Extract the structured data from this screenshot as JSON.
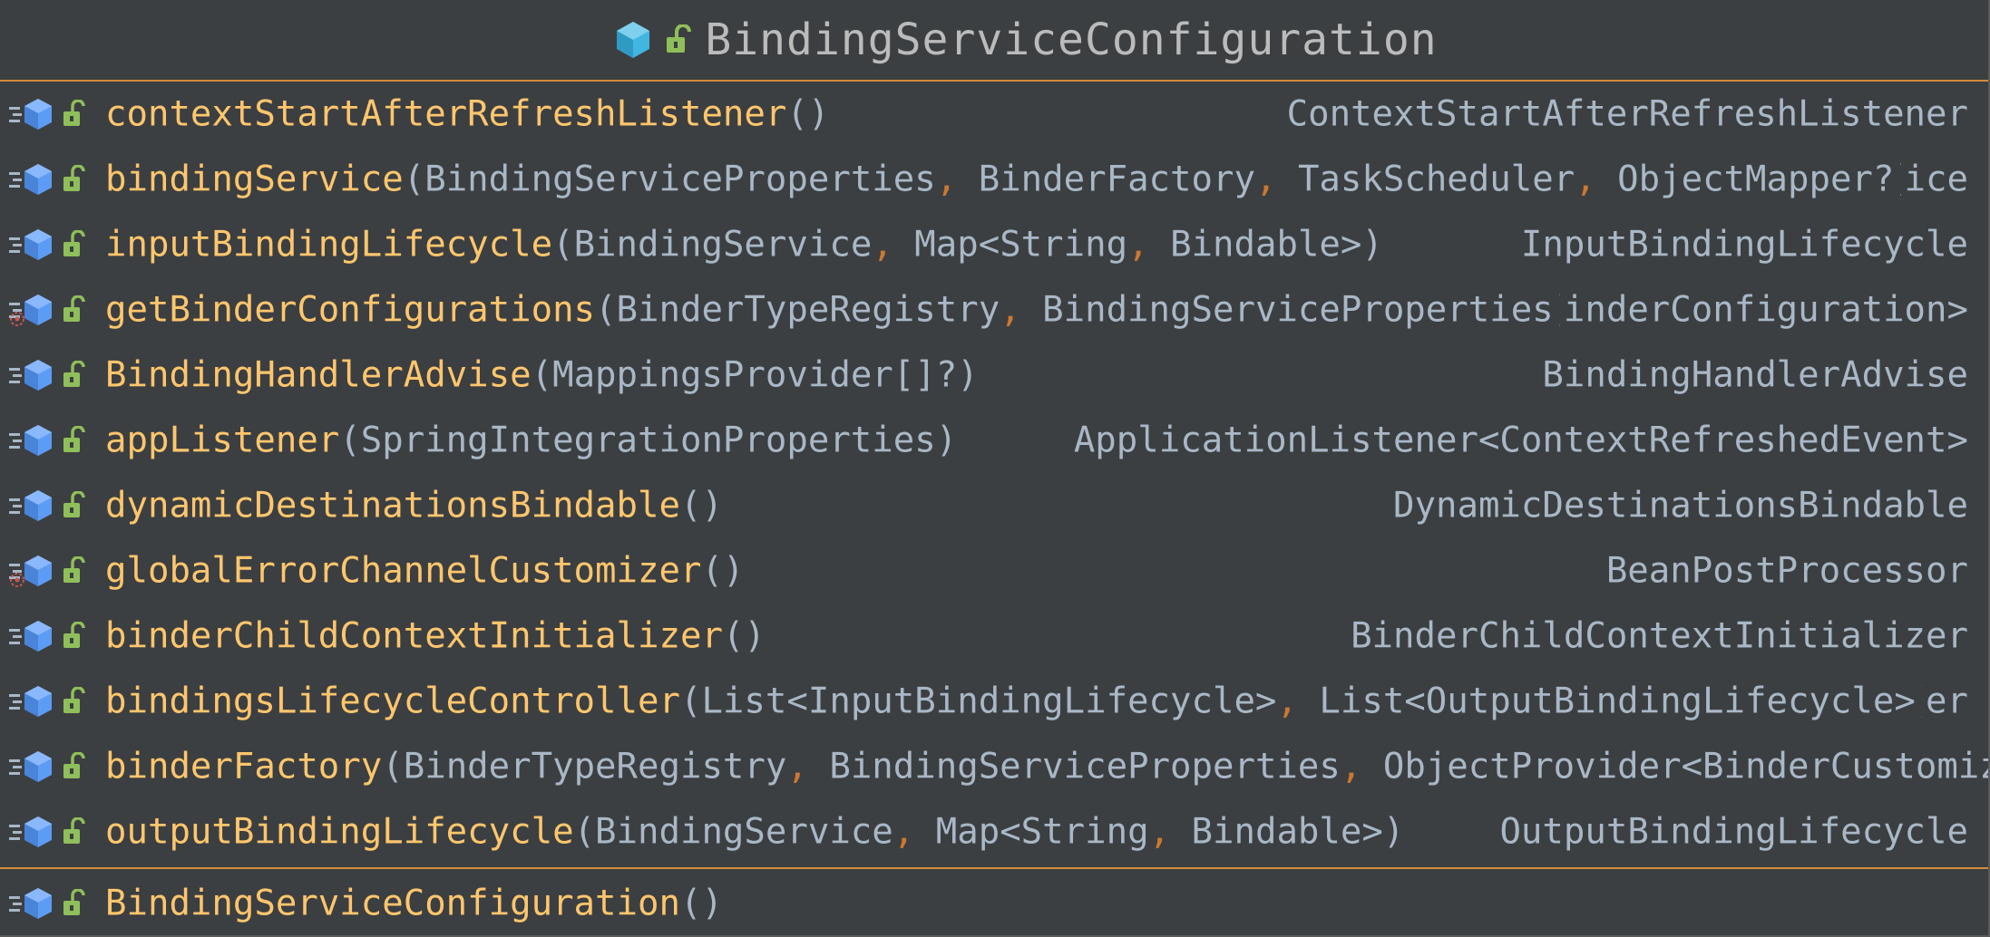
{
  "class_name": "BindingServiceConfiguration",
  "colors": {
    "background": "#3c3f41",
    "separator": "#d38b3a",
    "method_name": "#ffc66d",
    "text": "#a9b7c6",
    "comma": "#cc7832",
    "class_icon": "#40b6e0",
    "method_icon": "#5c9cf5",
    "lock_icon": "#8fbf5a",
    "bean_marker": "#c75450"
  },
  "methods": [
    {
      "name": "contextStartAfterRefreshListener",
      "params": "",
      "return_type": "ContextStartAfterRefreshListener",
      "bean_marker": false
    },
    {
      "name": "bindingService",
      "params": "BindingServiceProperties, BinderFactory, TaskScheduler, ObjectMapper?",
      "return_type": "ice",
      "bean_marker": false
    },
    {
      "name": "inputBindingLifecycle",
      "params": "BindingService, Map<String, Bindable>",
      "return_type": "InputBindingLifecycle",
      "bean_marker": false
    },
    {
      "name": "getBinderConfigurations",
      "params": "BinderTypeRegistry, BindingServiceProperties",
      "return_type": "inderConfiguration>",
      "bean_marker": true
    },
    {
      "name": "BindingHandlerAdvise",
      "params": "MappingsProvider[]?",
      "return_type": "BindingHandlerAdvise",
      "bean_marker": false
    },
    {
      "name": "appListener",
      "params": "SpringIntegrationProperties",
      "return_type": "ApplicationListener<ContextRefreshedEvent>",
      "bean_marker": false
    },
    {
      "name": "dynamicDestinationsBindable",
      "params": "",
      "return_type": "DynamicDestinationsBindable",
      "bean_marker": false
    },
    {
      "name": "globalErrorChannelCustomizer",
      "params": "",
      "return_type": "BeanPostProcessor",
      "bean_marker": true
    },
    {
      "name": "binderChildContextInitializer",
      "params": "",
      "return_type": "BinderChildContextInitializer",
      "bean_marker": false
    },
    {
      "name": "bindingsLifecycleController",
      "params": "List<InputBindingLifecycle>, List<OutputBindingLifecycle>",
      "return_type": "er",
      "bean_marker": false
    },
    {
      "name": "binderFactory",
      "params": "BinderTypeRegistry, BindingServiceProperties, ObjectProvider<BinderCustomiz",
      "return_type": "",
      "bean_marker": false,
      "params_unclosed": true
    },
    {
      "name": "outputBindingLifecycle",
      "params": "BindingService, Map<String, Bindable>",
      "return_type": "OutputBindingLifecycle",
      "bean_marker": false
    }
  ],
  "constructors": [
    {
      "name": "BindingServiceConfiguration",
      "params": "",
      "return_type": "",
      "bean_marker": false
    }
  ]
}
